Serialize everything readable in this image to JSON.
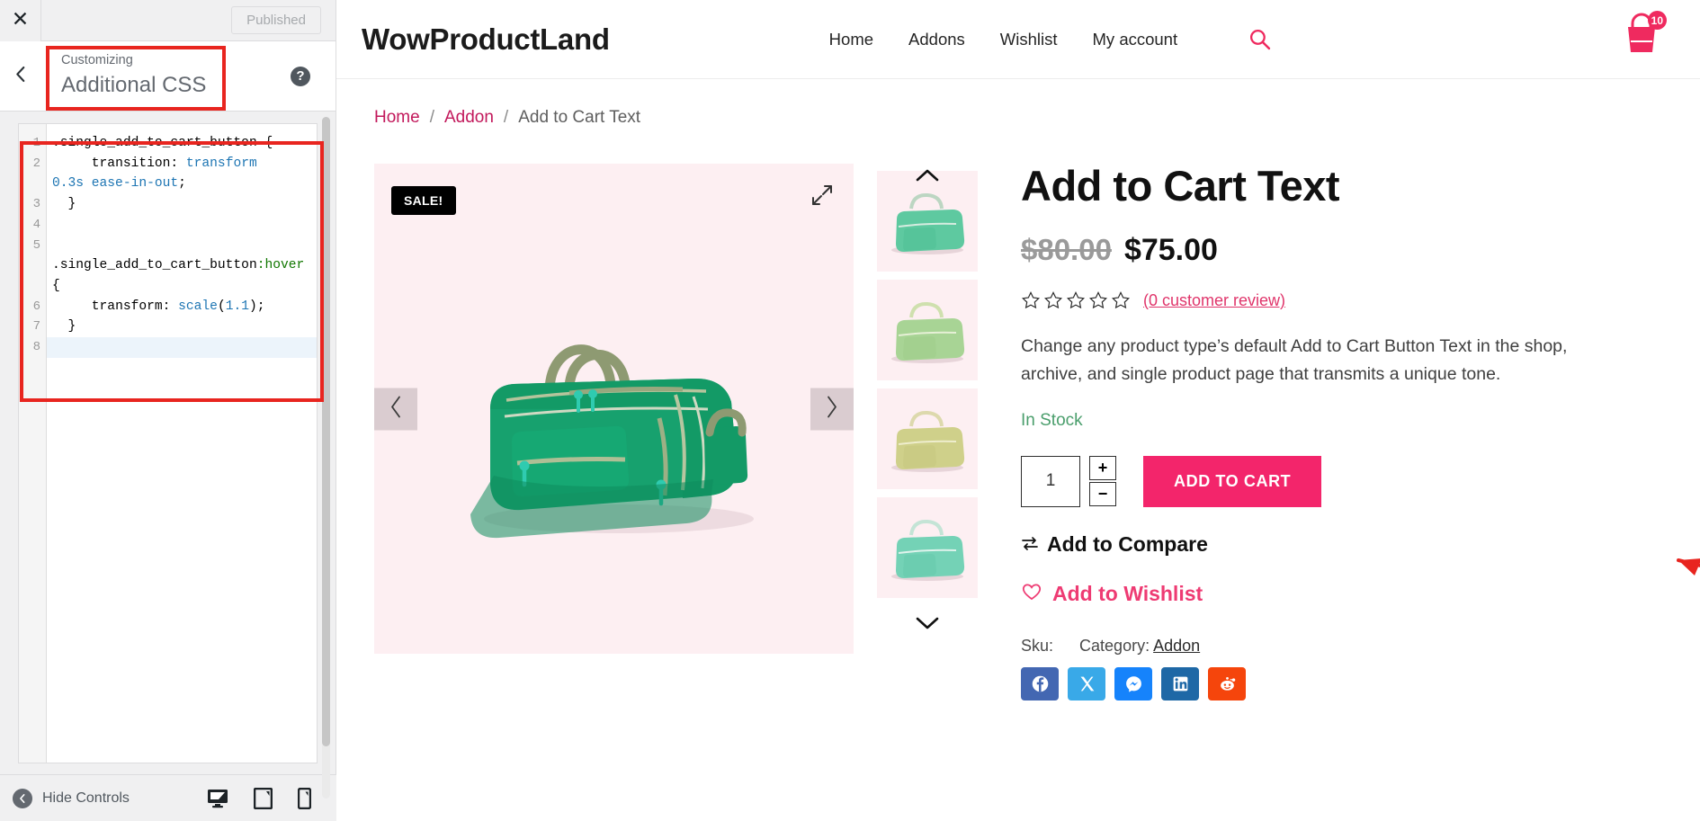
{
  "customizer": {
    "close_label": "close-icon",
    "published_label": "Published",
    "back_label": "back-icon",
    "section_subtitle": "Customizing",
    "section_title": "Additional CSS",
    "help_label": "?",
    "hide_controls_label": "Hide Controls",
    "devices": [
      {
        "name": "desktop",
        "label": "Desktop"
      },
      {
        "name": "tablet",
        "label": "Tablet"
      },
      {
        "name": "mobile",
        "label": "Mobile"
      }
    ],
    "code": {
      "line_numbers": [
        "1",
        "2",
        "",
        "3",
        "4",
        "5",
        "",
        "",
        "6",
        "7",
        "8"
      ],
      "lines": [
        ".single_add_to_cart_button {",
        "     transition: transform",
        "0.3s ease-in-out;",
        "  }",
        "",
        "",
        ".single_add_to_cart_button:hover",
        "{",
        "     transform: scale(1.1);",
        "  }",
        ""
      ],
      "raw": ".single_add_to_cart_button {\n     transition: transform 0.3s ease-in-out;\n  }\n\n\n.single_add_to_cart_button:hover {\n     transform: scale(1.1);\n  }\n"
    }
  },
  "site": {
    "brand": "WowProductLand",
    "nav": [
      {
        "label": "Home"
      },
      {
        "label": "Addons"
      },
      {
        "label": "Wishlist"
      },
      {
        "label": "My account"
      }
    ],
    "search_icon": "search-icon",
    "cart_count": "10",
    "breadcrumb": {
      "items": [
        "Home",
        "Addon"
      ],
      "separator": "/",
      "current": "Add to Cart Text"
    }
  },
  "product": {
    "sale_badge": "SALE!",
    "title": "Add to Cart Text",
    "old_price": "$80.00",
    "price": "$75.00",
    "rating_stars": 0,
    "review_link": "(0 customer review)",
    "description": "Change any product type’s default Add to Cart Button Text in the shop, archive, and single product page that transmits a unique tone.",
    "stock_status": "In Stock",
    "quantity": "1",
    "qty_plus": "+",
    "qty_minus": "−",
    "add_to_cart_label": "ADD TO CART",
    "compare_label": "Add to Compare",
    "wishlist_label": "Add to Wishlist",
    "sku_label": "Sku:",
    "sku_value": "",
    "category_label": "Category:",
    "category_value": "Addon",
    "socials": [
      {
        "name": "facebook",
        "color": "#4367b2"
      },
      {
        "name": "x-twitter",
        "color": "#39a9e8"
      },
      {
        "name": "messenger",
        "color": "#1683fb"
      },
      {
        "name": "linkedin",
        "color": "#1e68a6"
      },
      {
        "name": "reddit",
        "color": "#f5450c"
      }
    ],
    "thumbnails": [
      {
        "name": "thumb-1",
        "color": "#5ec9a0"
      },
      {
        "name": "thumb-2",
        "color": "#a8d495"
      },
      {
        "name": "thumb-3",
        "color": "#cfd08a"
      },
      {
        "name": "thumb-4",
        "color": "#74d2b6"
      }
    ]
  },
  "colors": {
    "accent": "#f3256b",
    "link": "#c2185b",
    "annotation": "#e8251f",
    "stock": "#4a9e6c",
    "bg_product": "#fdeff2"
  }
}
